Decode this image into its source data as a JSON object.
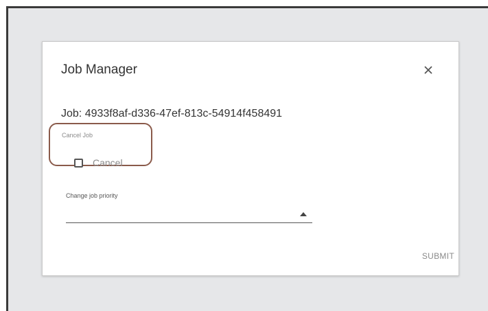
{
  "dialog": {
    "title": "Job Manager",
    "close_icon": "close-icon",
    "job_label": "Job: 4933f8af-d336-47ef-813c-54914f458491"
  },
  "cancel_section": {
    "legend": "Cancel Job",
    "checkbox_label": "Cancel",
    "checked": false,
    "highlight_color": "#8a5a4a"
  },
  "priority_select": {
    "label": "Change job priority",
    "value": "",
    "arrow_icon": "triangle-up-icon"
  },
  "actions": {
    "submit_label": "SUBMIT"
  },
  "colors": {
    "backdrop": "#e6e7e9",
    "dialog_bg": "#ffffff",
    "text_primary": "#333333",
    "text_disabled": "#8a8a8a"
  }
}
